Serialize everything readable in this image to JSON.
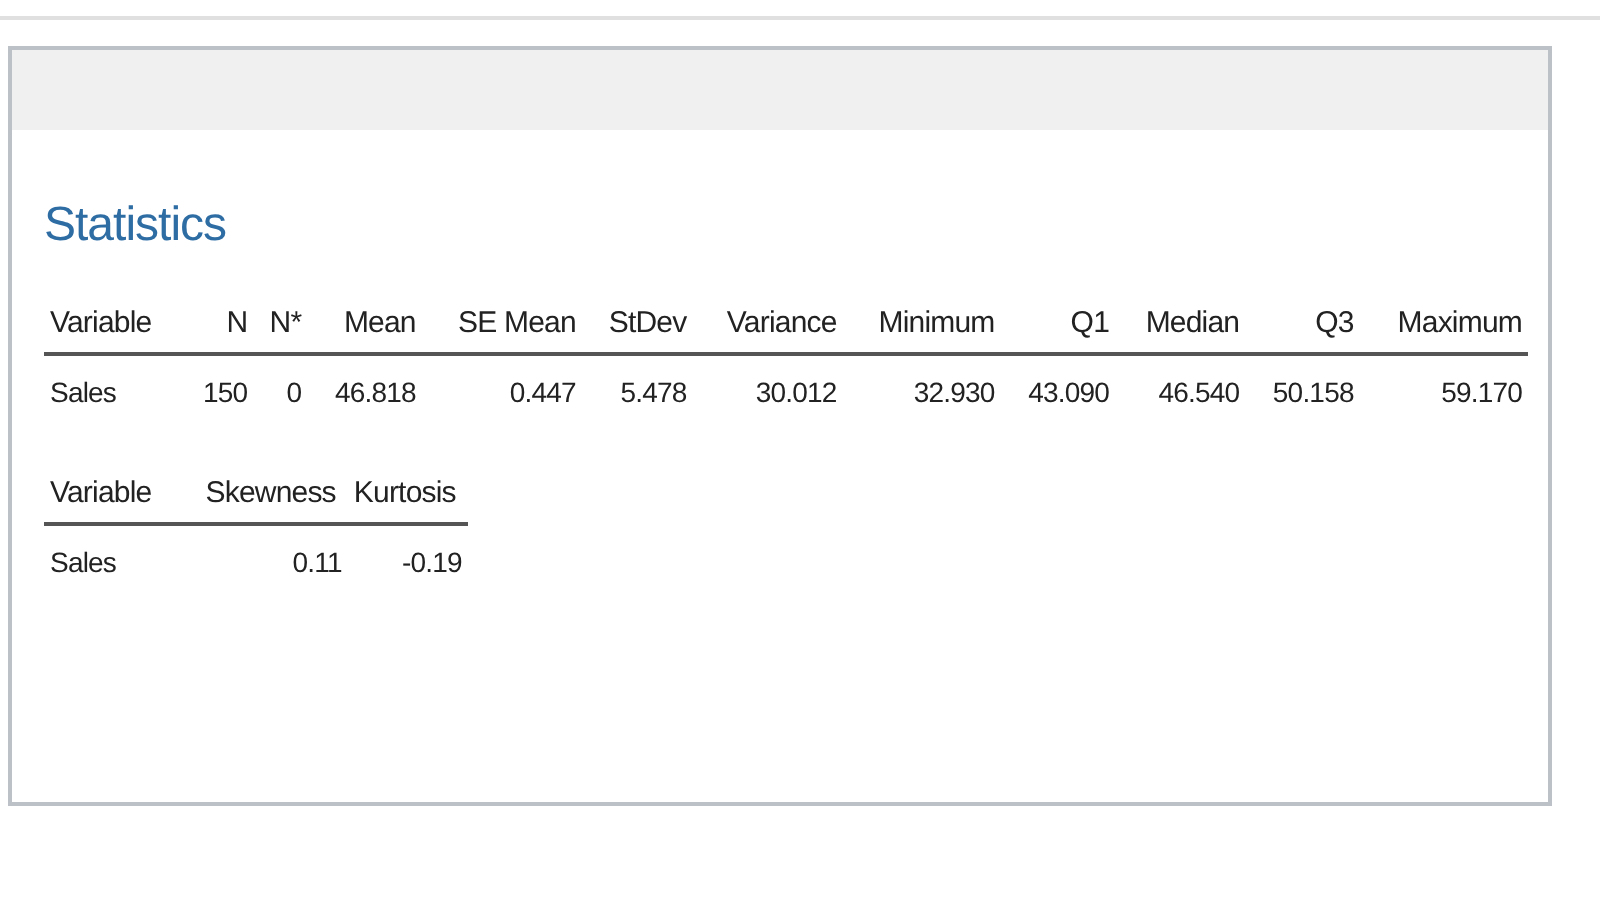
{
  "section_title": "Statistics",
  "tables": [
    {
      "columns": [
        "Variable",
        "N",
        "N*",
        "Mean",
        "SE Mean",
        "StDev",
        "Variance",
        "Minimum",
        "Q1",
        "Median",
        "Q3",
        "Maximum"
      ],
      "rows": [
        [
          "Sales",
          "150",
          "0",
          "46.818",
          "0.447",
          "5.478",
          "30.012",
          "32.930",
          "43.090",
          "46.540",
          "50.158",
          "59.170"
        ]
      ]
    },
    {
      "columns": [
        "Variable",
        "Skewness",
        "Kurtosis"
      ],
      "rows": [
        [
          "Sales",
          "0.11",
          "-0.19"
        ]
      ]
    }
  ]
}
